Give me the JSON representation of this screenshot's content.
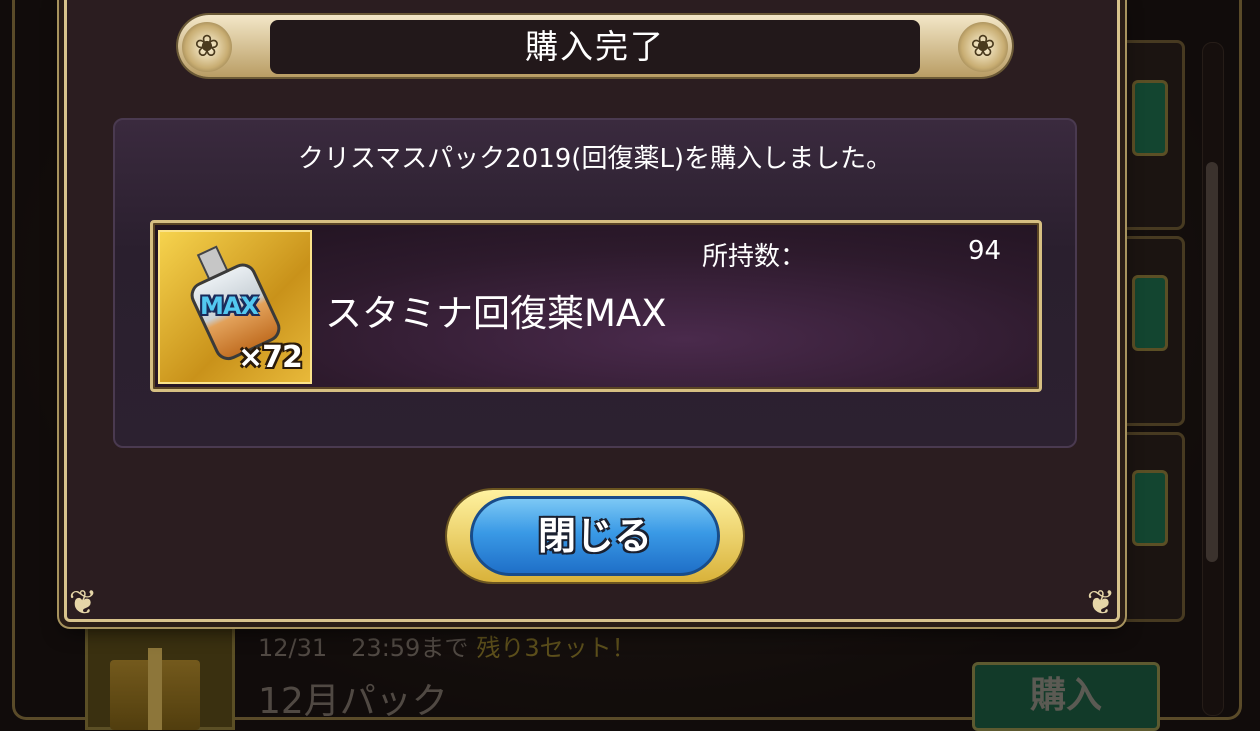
{
  "dialog": {
    "title": "購入完了",
    "message": "クリスマスパック2019(回復薬L)を購入しました。",
    "item": {
      "name": "スタミナ回復薬MAX",
      "icon": "stamina-potion-max-icon",
      "icon_badge": "MAX",
      "quantity": "×72",
      "owned_label": "所持数：",
      "owned_value": "94"
    },
    "close_label": "閉じる"
  },
  "background_shop": {
    "deadline": "12/31　23:59まで",
    "remaining": "残り3セット！",
    "pack_title": "12月パック",
    "buy_label": "購入"
  },
  "colors": {
    "frame_gold": "#d8c38c",
    "dialog_bg": "#2b1d20",
    "button_blue": "#3a9ae6",
    "buy_green": "#1c5a40"
  }
}
